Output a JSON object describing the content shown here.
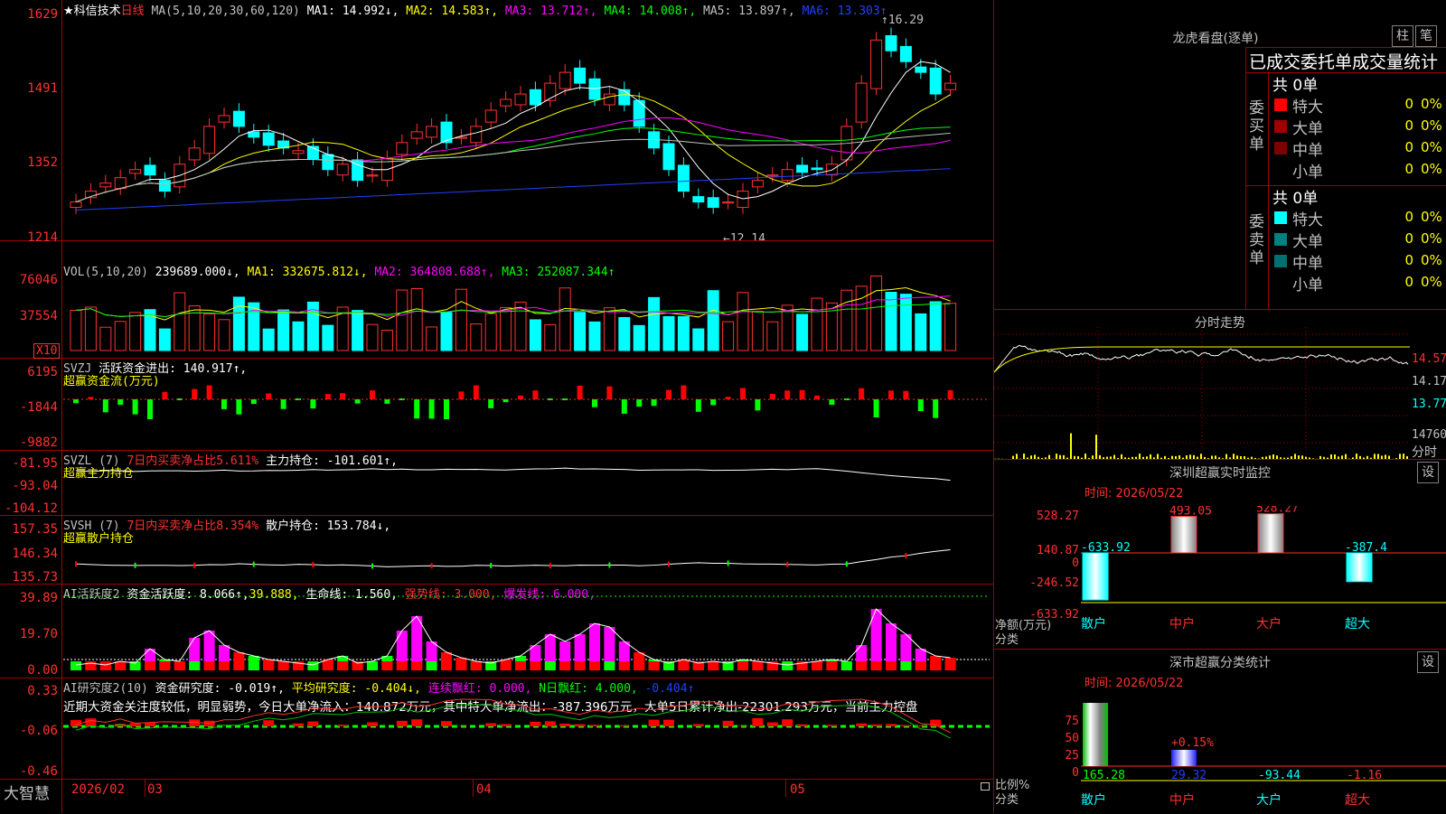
{
  "stock": {
    "name": "★科信技术",
    "period": "日线",
    "ma_header": "MA(5,10,20,30,60,120)",
    "ma1": "MA1: 14.992↓,",
    "ma2": "MA2: 14.583↑,",
    "ma3": "MA3: 13.712↑,",
    "ma4": "MA4: 14.008↑,",
    "ma5": "MA5: 13.897↑,",
    "ma6": "MA6: 13.303↑",
    "high_mark": "16.29",
    "low_mark": "12.14",
    "price_axis": [
      "1629",
      "1491",
      "1352",
      "1214"
    ]
  },
  "vol": {
    "header": "VOL(5,10,20)",
    "value": "239689.000↓,",
    "ma1": "MA1: 332675.812↓,",
    "ma2": "MA2: 364808.688↑,",
    "ma3": "MA3: 252087.344↑",
    "axis": [
      "76046",
      "37554"
    ],
    "unit": "X10"
  },
  "svzj": {
    "header": "SVZJ",
    "label": "活跃资金进出: 140.917↑,",
    "sub": "超赢资金流(万元)",
    "axis": [
      "6195",
      "-1844",
      "-9882"
    ]
  },
  "svzl": {
    "header": "SVZL (7)",
    "ratio": "7日内买卖净占比5.611%",
    "hold": "主力持仓: -101.601↑,",
    "sub": "超赢主力持仓",
    "axis": [
      "-81.95",
      "-93.04",
      "-104.12"
    ]
  },
  "svsh": {
    "header": "SVSH (7)",
    "ratio": "7日内买卖净占比8.354%",
    "hold": "散户持仓: 153.784↓,",
    "sub": "超赢散户持仓",
    "axis": [
      "157.35",
      "146.34",
      "135.73"
    ]
  },
  "ai_active": {
    "header": "AI活跃度2",
    "act": "资金活跃度: 8.066↑,",
    "v2": "39.888,",
    "life": "生命线: 1.560,",
    "strong": "强势线: 3.000,",
    "burst": "爆发线: 6.000,",
    "axis": [
      "39.89",
      "19.70",
      "0.00"
    ]
  },
  "ai_research": {
    "header": "AI研究度2(10)",
    "res": "资金研究度: -0.019↑,",
    "avg": "平均研究度: -0.404↓,",
    "red": "连续飘红: 0.000,",
    "nred": "N日飘红: 4.000,",
    "tail": "-0.404↑",
    "comment": "近期大资金关注度较低，明显弱势，今日大单净流入：140.872万元，其中特大单净流出：-387.396万元，大单5日累计净出-22301.293万元，当前主力控盘",
    "axis": [
      "0.33",
      "-0.06",
      "-0.46"
    ]
  },
  "xaxis": {
    "brand": "大智慧",
    "labels": [
      "2026/02",
      "03",
      "04",
      "05"
    ]
  },
  "right": {
    "lhb_title": "龙虎看盘(逐单)",
    "btn_zhu": "柱",
    "btn_bi": "笔",
    "stats_title": "已成交委托单成交量统计",
    "buy_side": "委买单",
    "sell_side": "委卖单",
    "buy_total": "共 0单",
    "sell_total": "共 0单",
    "buy_rows": [
      {
        "name": "特大",
        "count": "0",
        "pct": "0%",
        "color": "#ff0000"
      },
      {
        "name": "大单",
        "count": "0",
        "pct": "0%",
        "color": "#a00000"
      },
      {
        "name": "中单",
        "count": "0",
        "pct": "0%",
        "color": "#800000"
      },
      {
        "name": "小单",
        "count": "0",
        "pct": "0%",
        "color": "#000000"
      }
    ],
    "sell_rows": [
      {
        "name": "特大",
        "count": "0",
        "pct": "0%",
        "color": "#00ffff"
      },
      {
        "name": "大单",
        "count": "0",
        "pct": "0%",
        "color": "#008080"
      },
      {
        "name": "中单",
        "count": "0",
        "pct": "0%",
        "color": "#007070"
      },
      {
        "name": "小单",
        "count": "0",
        "pct": "0%",
        "color": "#000000"
      }
    ],
    "intraday_title": "分时走势",
    "intraday_axis": [
      "14.57",
      "14.17",
      "13.77",
      "14760"
    ],
    "intraday_unit": "分时",
    "monitor_title": "深圳超赢实时监控",
    "monitor_btn": "设",
    "monitor_time": "时间: 2026/05/22",
    "monitor_axis": [
      "528.27",
      "140.87",
      "0",
      "-246.52",
      "-633.92"
    ],
    "monitor_unit": "净额(万元)",
    "monitor_cat": "分类",
    "monitor_bars": [
      {
        "cat": "散户",
        "value": "-633.92"
      },
      {
        "cat": "中户",
        "value": "493.05"
      },
      {
        "cat": "大户",
        "value": "528.27"
      },
      {
        "cat": "超大",
        "value": "-387.4"
      }
    ],
    "class_title": "深市超赢分类统计",
    "class_btn": "设",
    "class_time": "时间: 2026/05/22",
    "class_axis": [
      "75",
      "50",
      "25",
      "0"
    ],
    "class_unit": "比例%",
    "class_cat": "分类",
    "class_mid_label": "+0.15%",
    "class_bars": [
      {
        "cat": "散户",
        "value": "165.28"
      },
      {
        "cat": "中户",
        "value": "29.32"
      },
      {
        "cat": "大户",
        "value": "-93.44"
      },
      {
        "cat": "超大",
        "value": "-1.16"
      }
    ]
  }
}
